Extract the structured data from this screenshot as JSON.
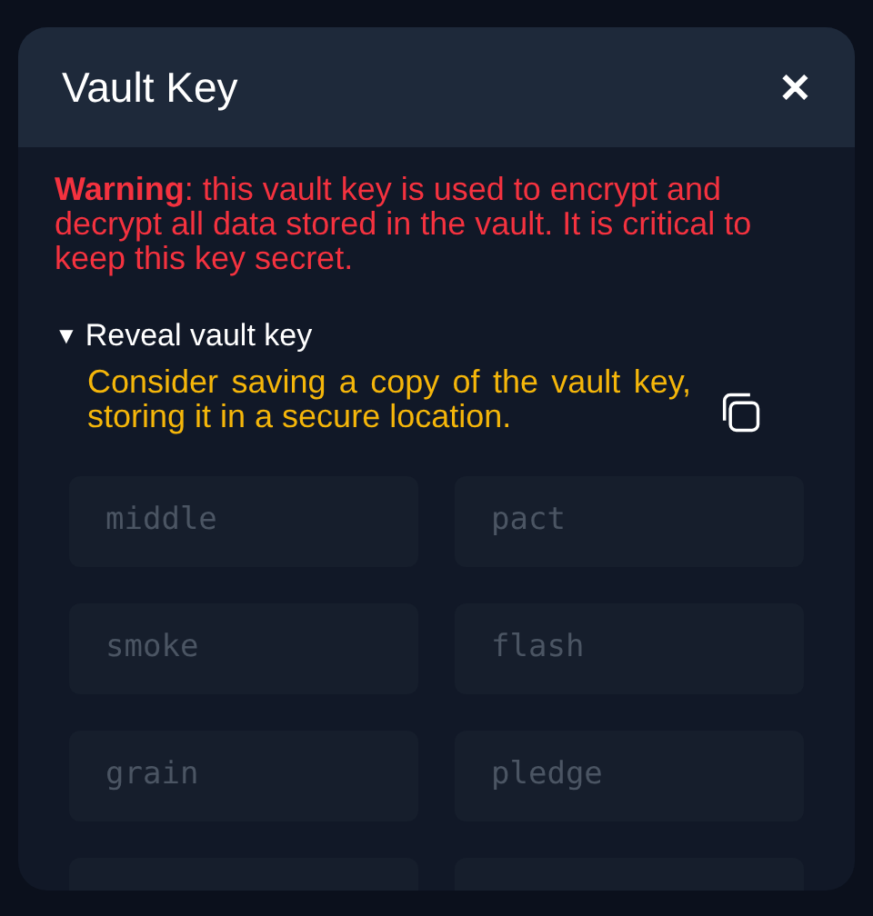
{
  "dialog": {
    "title": "Vault Key",
    "close": "✕",
    "warning": "**Warning**: this vault key is used to encrypt and decrypt all data stored in the vault. It is critical to keep this key secret.",
    "reveal": {
      "marker": "▼",
      "label": "Reveal vault key",
      "expanded": true
    },
    "note": "Consider saving a copy of the vault key, storing it in a secure location.",
    "words": [
      "middle",
      "pact",
      "smoke",
      "flash",
      "grain",
      "pledge"
    ]
  }
}
